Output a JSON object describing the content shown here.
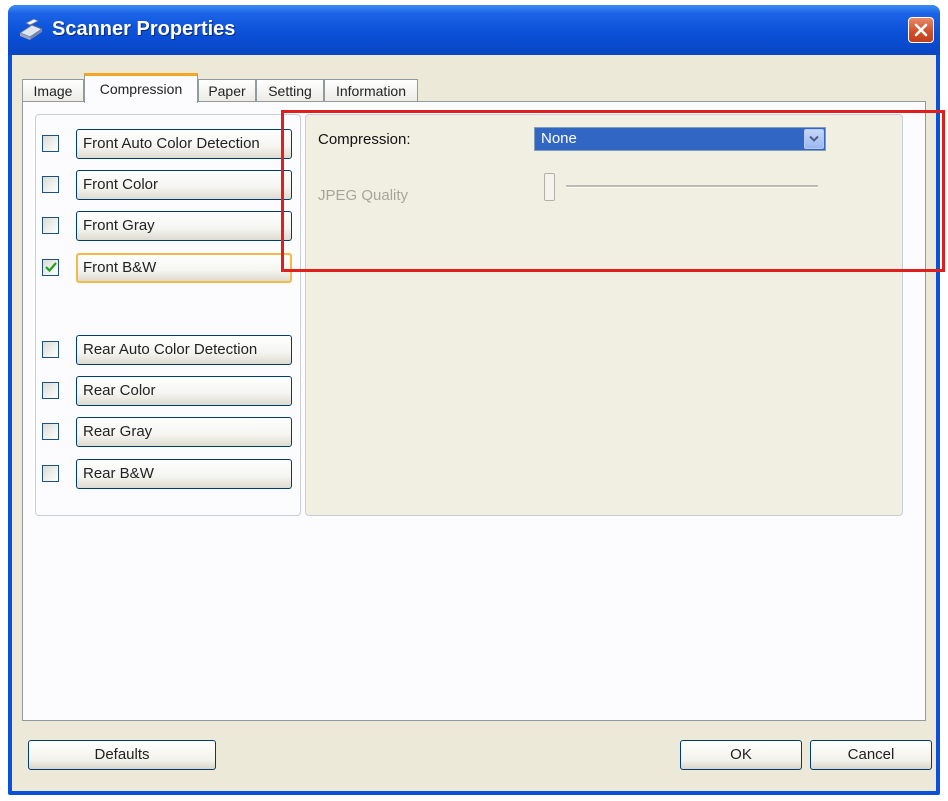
{
  "window": {
    "title": "Scanner Properties"
  },
  "tabs": [
    {
      "label": "Image"
    },
    {
      "label": "Compression"
    },
    {
      "label": "Paper"
    },
    {
      "label": "Setting"
    },
    {
      "label": "Information"
    }
  ],
  "active_tab": "Compression",
  "image_options": [
    {
      "label": "Front Auto Color Detection",
      "checked": false
    },
    {
      "label": "Front Color",
      "checked": false
    },
    {
      "label": "Front Gray",
      "checked": false
    },
    {
      "label": "Front B&W",
      "checked": true
    },
    {
      "label": "Rear Auto Color Detection",
      "checked": false
    },
    {
      "label": "Rear Color",
      "checked": false
    },
    {
      "label": "Rear Gray",
      "checked": false
    },
    {
      "label": "Rear B&W",
      "checked": false
    }
  ],
  "compression": {
    "label": "Compression:",
    "value": "None"
  },
  "jpeg_quality": {
    "label": "JPEG Quality",
    "enabled": false,
    "level": 0
  },
  "buttons": {
    "defaults": "Defaults",
    "ok": "OK",
    "cancel": "Cancel"
  },
  "colors": {
    "titlebar": "#0a4fd6",
    "highlight": "#e01e1e",
    "active_tab_accent": "#f4a623",
    "select_bg": "#3166c4"
  }
}
